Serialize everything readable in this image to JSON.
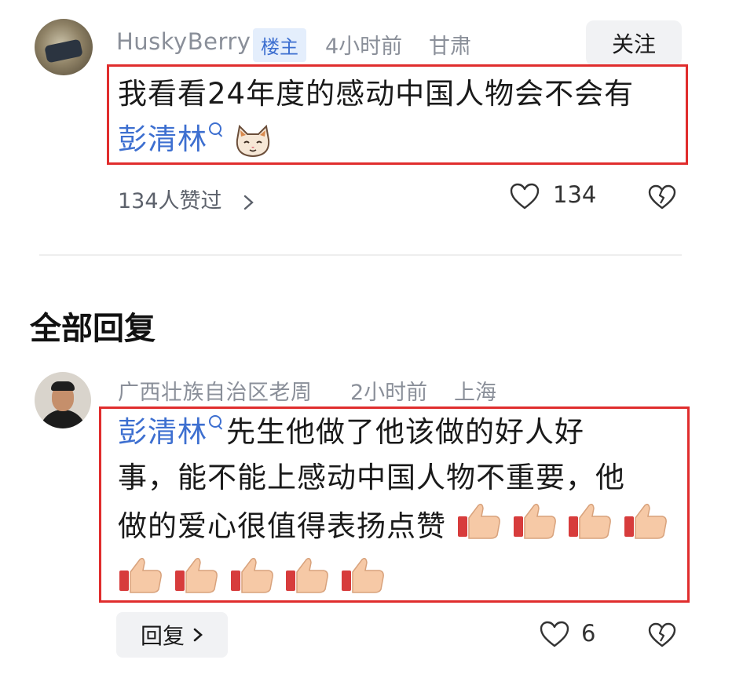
{
  "op_comment": {
    "username": "HuskyBerry",
    "badge": "楼主",
    "time": "4小时前",
    "location": "甘肃",
    "follow_label": "关注",
    "text_line1": "我看看24年度的感动中国人物会不会有",
    "mention": "彭清林",
    "liked_by": "134人赞过",
    "like_count": "134"
  },
  "section_title": "全部回复",
  "reply_comment": {
    "username": "广西壮族自治区老周",
    "time": "2小时前",
    "location": "上海",
    "mention": "彭清林",
    "text_line1_rest": "先生他做了他该做的好人好",
    "text_line2": "事，能不能上感动中国人物不重要，他",
    "text_line3": "做的爱心很值得表扬点赞",
    "reply_label": "回复",
    "like_count": "6"
  },
  "colors": {
    "highlight_border": "#e02d2d",
    "mention": "#3d6fd0",
    "meta_gray": "#8a8f99",
    "badge_bg": "#e4eefc"
  },
  "icons": {
    "like": "heart-outline-icon",
    "dislike": "broken-heart-icon",
    "chevron": "chevron-right-icon",
    "search": "search-icon",
    "emoji_cat": "cat-emoji-icon",
    "emoji_thumbs": "thumbs-up-emoji-icon"
  }
}
